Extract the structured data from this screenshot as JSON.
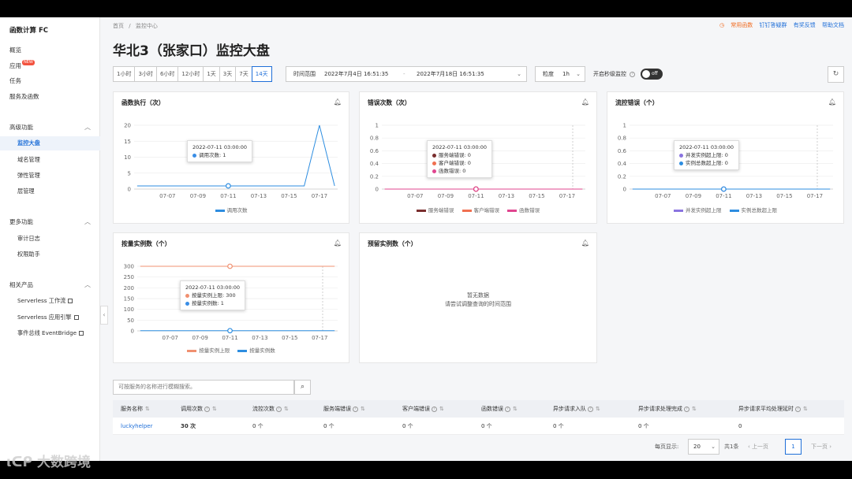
{
  "sidebar": {
    "title": "函数计算 FC",
    "items": [
      {
        "label": "概览"
      },
      {
        "label": "应用",
        "badge": "NEW"
      },
      {
        "label": "任务"
      },
      {
        "label": "服务及函数"
      }
    ],
    "advanced": {
      "label": "高级功能",
      "items": [
        {
          "label": "监控大盘"
        },
        {
          "label": "域名管理"
        },
        {
          "label": "弹性管理"
        },
        {
          "label": "层管理"
        }
      ]
    },
    "more": {
      "label": "更多功能",
      "items": [
        {
          "label": "审计日志"
        },
        {
          "label": "权限助手"
        }
      ]
    },
    "related": {
      "label": "相关产品",
      "items": [
        {
          "label": "Serverless 工作流"
        },
        {
          "label": "Serverless 应用引擎"
        },
        {
          "label": "事件总线 EventBridge"
        }
      ]
    }
  },
  "header": {
    "crumb_home": "首页",
    "crumb_sep": "/",
    "crumb_current": "监控中心",
    "title": "华北3（张家口）监控大盘",
    "links": {
      "common": "常用函数",
      "dingtalk": "钉钉答疑群",
      "feedback": "有奖反馈",
      "docs": "帮助文档"
    }
  },
  "controls": {
    "ranges": [
      "1小时",
      "3小时",
      "6小时",
      "12小时",
      "1天",
      "3天",
      "7天",
      "14天"
    ],
    "time_label": "时间范围",
    "start": "2022年7月4日 16:51:35",
    "dash": "-",
    "end": "2022年7月18日 16:51:35",
    "gran_label": "粒度",
    "gran_value": "1h",
    "sec_label": "开启秒级监控",
    "toggle": "off"
  },
  "cards": {
    "exec": {
      "title": "函数执行（次）"
    },
    "errors": {
      "title": "错误次数（次）"
    },
    "throttle": {
      "title": "流控错误（个）"
    },
    "ondemand": {
      "title": "按量实例数（个）"
    },
    "reserved": {
      "title": "预留实例数（个）",
      "empty1": "暂无数据",
      "empty2": "请尝试调整查询的时间范围"
    }
  },
  "tooltips": {
    "exec": {
      "time": "2022-07-11 03:00:00",
      "rows": [
        {
          "label": "调用次数: 1",
          "color": "#3a8ee6"
        }
      ]
    },
    "errors": {
      "time": "2022-07-11 03:00:00",
      "rows": [
        {
          "label": "服务端错误: 0",
          "color": "#7a2e2e"
        },
        {
          "label": "客户端错误: 0",
          "color": "#f07050"
        },
        {
          "label": "函数错误: 0",
          "color": "#e0458f"
        }
      ]
    },
    "throttle": {
      "time": "2022-07-11 03:00:00",
      "rows": [
        {
          "label": "并发实例超上限: 0",
          "color": "#8a74e0"
        },
        {
          "label": "实例总数超上限: 0",
          "color": "#2d8de0"
        }
      ]
    },
    "ondemand": {
      "time": "2022-07-11 03:00:00",
      "rows": [
        {
          "label": "按量实例上限: 300",
          "color": "#f09070"
        },
        {
          "label": "按量实例数: 1",
          "color": "#3a8ee6"
        }
      ]
    }
  },
  "chart_data": [
    {
      "type": "line",
      "title": "函数执行（次）",
      "x": [
        "07-05",
        "07-06",
        "07-07",
        "07-08",
        "07-09",
        "07-10",
        "07-11",
        "07-12",
        "07-13",
        "07-14",
        "07-15",
        "07-16",
        "07-17",
        "07-18"
      ],
      "xticks": [
        "07-07",
        "07-09",
        "07-11",
        "07-13",
        "07-15",
        "07-17"
      ],
      "series": [
        {
          "name": "调用次数",
          "color": "#2d8de0",
          "values": [
            1,
            1,
            1,
            1,
            1,
            1,
            1,
            1,
            1,
            1,
            1,
            1,
            20,
            1
          ]
        }
      ],
      "ylim": [
        0,
        20
      ],
      "yticks": [
        0,
        5,
        10,
        15,
        20
      ]
    },
    {
      "type": "line",
      "title": "错误次数（次）",
      "xticks": [
        "07-07",
        "07-09",
        "07-11",
        "07-13",
        "07-15",
        "07-17"
      ],
      "series": [
        {
          "name": "服务端错误",
          "color": "#7a2e2e",
          "values": [
            0,
            0,
            0,
            0,
            0,
            0,
            0,
            0,
            0,
            0,
            0,
            0,
            0,
            0
          ]
        },
        {
          "name": "客户端错误",
          "color": "#f07050",
          "values": [
            0,
            0,
            0,
            0,
            0,
            0,
            0,
            0,
            0,
            0,
            0,
            0,
            0,
            0
          ]
        },
        {
          "name": "函数错误",
          "color": "#e0458f",
          "values": [
            0,
            0,
            0,
            0,
            0,
            0,
            0,
            0,
            0,
            0,
            0,
            0,
            0,
            0
          ]
        }
      ],
      "ylim": [
        0,
        1
      ],
      "yticks": [
        0,
        0.2,
        0.4,
        0.6,
        0.8,
        1
      ]
    },
    {
      "type": "line",
      "title": "流控错误（个）",
      "xticks": [
        "07-07",
        "07-09",
        "07-11",
        "07-13",
        "07-15",
        "07-17"
      ],
      "series": [
        {
          "name": "并发实例超上限",
          "color": "#8a74e0",
          "values": [
            0,
            0,
            0,
            0,
            0,
            0,
            0,
            0,
            0,
            0,
            0,
            0,
            0,
            0
          ]
        },
        {
          "name": "实例总数超上限",
          "color": "#2d8de0",
          "values": [
            0,
            0,
            0,
            0,
            0,
            0,
            0,
            0,
            0,
            0,
            0,
            0,
            0,
            0
          ]
        }
      ],
      "ylim": [
        0,
        1
      ],
      "yticks": [
        0,
        0.2,
        0.4,
        0.6,
        0.8,
        1
      ]
    },
    {
      "type": "line",
      "title": "按量实例数（个）",
      "xticks": [
        "07-07",
        "07-09",
        "07-11",
        "07-13",
        "07-15",
        "07-17"
      ],
      "series": [
        {
          "name": "按量实例上限",
          "color": "#f09070",
          "values": [
            300,
            300,
            300,
            300,
            300,
            300,
            300,
            300,
            300,
            300,
            300,
            300,
            300,
            300
          ]
        },
        {
          "name": "按量实例数",
          "color": "#2d8de0",
          "values": [
            1,
            1,
            1,
            1,
            1,
            1,
            1,
            1,
            1,
            1,
            1,
            1,
            1,
            1
          ]
        }
      ],
      "ylim": [
        0,
        300
      ],
      "yticks": [
        0,
        50,
        100,
        150,
        200,
        250,
        300
      ]
    }
  ],
  "search": {
    "placeholder": "可按服务的名称进行模糊搜索。"
  },
  "table": {
    "headers": [
      "服务名称",
      "调用次数",
      "流控次数",
      "服务端错误",
      "客户端错误",
      "函数错误",
      "异步请求入队",
      "异步请求处理完成",
      "异步请求平均处理延时"
    ],
    "row": [
      "luckyhelper",
      "30 次",
      "0 个",
      "0 个",
      "0 个",
      "0 个",
      "0 个",
      "0 个",
      "0"
    ]
  },
  "pager": {
    "per_page_label": "每页显示:",
    "per_page": "20",
    "total": "共1条",
    "prev": "上一页",
    "page": "1",
    "next": "下一页"
  },
  "watermark": "大数跨境",
  "colors": {
    "accent": "#1f6fd8",
    "warn": "#f06b20"
  }
}
